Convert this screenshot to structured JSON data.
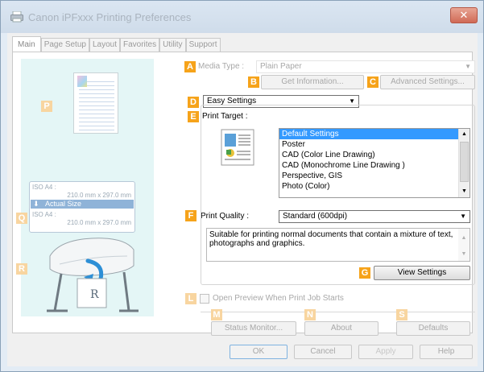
{
  "window": {
    "title": "Canon iPFxxx Printing Preferences",
    "close_label": "✕"
  },
  "tabs": [
    "Main",
    "Page Setup",
    "Layout",
    "Favorites",
    "Utility",
    "Support"
  ],
  "badges": {
    "A": "A",
    "B": "B",
    "C": "C",
    "D": "D",
    "E": "E",
    "F": "F",
    "G": "G",
    "L": "L",
    "M": "M",
    "N": "N",
    "S": "S",
    "P": "P",
    "Q": "Q",
    "R": "R"
  },
  "media_type": {
    "label": "Media Type :",
    "value": "Plain Paper"
  },
  "get_information_button": "Get Information...",
  "advanced_settings_button": "Advanced Settings...",
  "mode_select": {
    "value": "Easy Settings"
  },
  "print_target": {
    "label": "Print Target :",
    "items": [
      "Default Settings",
      "Poster",
      "CAD (Color Line Drawing)",
      "CAD (Monochrome Line Drawing )",
      "Perspective, GIS",
      "Photo (Color)"
    ],
    "selected_index": 0
  },
  "print_quality": {
    "label": "Print Quality :",
    "value": "Standard (600dpi)"
  },
  "description": "Suitable for printing normal documents that contain a mixture of text, photographs and graphics.",
  "view_settings_button": "View Settings",
  "open_preview": {
    "label": "Open Preview When Print Job Starts",
    "checked": false
  },
  "status_monitor_button": "Status Monitor...",
  "about_button": "About",
  "defaults_button": "Defaults",
  "preview": {
    "paper_size_1": "ISO A4 :",
    "paper_dim_1": "210.0 mm x 297.0 mm",
    "actual_size": "Actual Size",
    "paper_size_2": "ISO A4 :",
    "paper_dim_2": "210.0 mm x 297.0 mm"
  },
  "footer": {
    "ok": "OK",
    "cancel": "Cancel",
    "apply": "Apply",
    "help": "Help"
  },
  "colors": {
    "badge": "#f6a31a",
    "preview_bg": "#e4f6f6",
    "selection": "#3399ff"
  }
}
